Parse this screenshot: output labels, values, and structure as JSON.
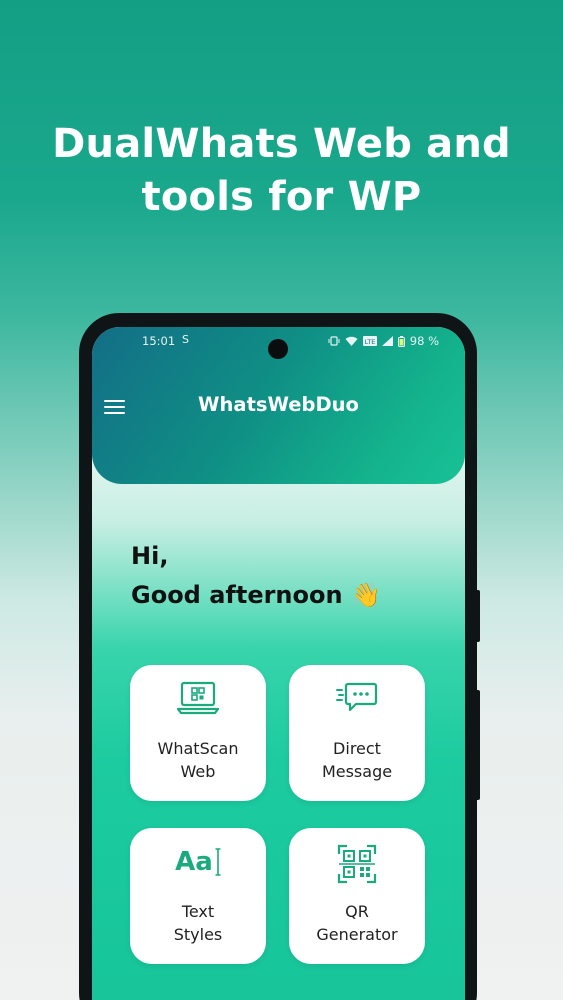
{
  "headline": {
    "line1": "DualWhats Web and",
    "line2": "tools for WP"
  },
  "statusbar": {
    "time": "15:01",
    "extra": "S",
    "battery": "98 %"
  },
  "app": {
    "title": "WhatsWebDuo",
    "greeting_line1": "Hi,",
    "greeting_line2": "Good afternoon 👋"
  },
  "cards": [
    {
      "label": "WhatScan\nWeb",
      "icon": "laptop-qr-icon"
    },
    {
      "label": "Direct\nMessage",
      "icon": "chat-bubble-icon"
    },
    {
      "label": "Text\nStyles",
      "icon": "text-aa-icon",
      "icon_text": "Aa"
    },
    {
      "label": "QR\nGenerator",
      "icon": "qr-code-icon"
    }
  ],
  "colors": {
    "accent": "#1aaa7d",
    "header_start": "#136e86",
    "header_end": "#18c196",
    "background": "#139f84"
  }
}
